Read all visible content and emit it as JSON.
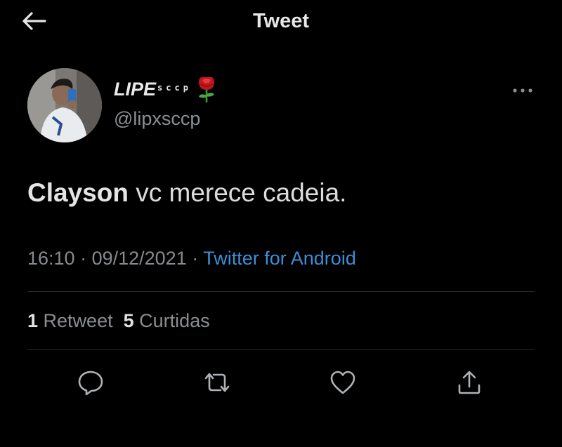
{
  "header": {
    "title": "Tweet"
  },
  "author": {
    "name": "LIPE",
    "name_superscript": "sccp",
    "handle": "@lipxsccp"
  },
  "tweet": {
    "mention": "Clayson",
    "text": " vc merece cadeia."
  },
  "meta": {
    "time": "16:10",
    "separator": " · ",
    "date": "09/12/2021",
    "source": "Twitter for Android"
  },
  "stats": {
    "retweets_count": "1",
    "retweets_label": "Retweet",
    "likes_count": "5",
    "likes_label": "Curtidas"
  },
  "icons": {
    "back": "arrow-left-icon",
    "more": "more-horizontal-icon",
    "reply": "reply-icon",
    "retweet": "retweet-icon",
    "like": "heart-icon",
    "share": "share-icon",
    "emoji": "rose-icon"
  },
  "colors": {
    "background": "#000000",
    "link": "#3b8fd9",
    "secondary_text": "#8b8f94",
    "rose": "#c0151c"
  }
}
